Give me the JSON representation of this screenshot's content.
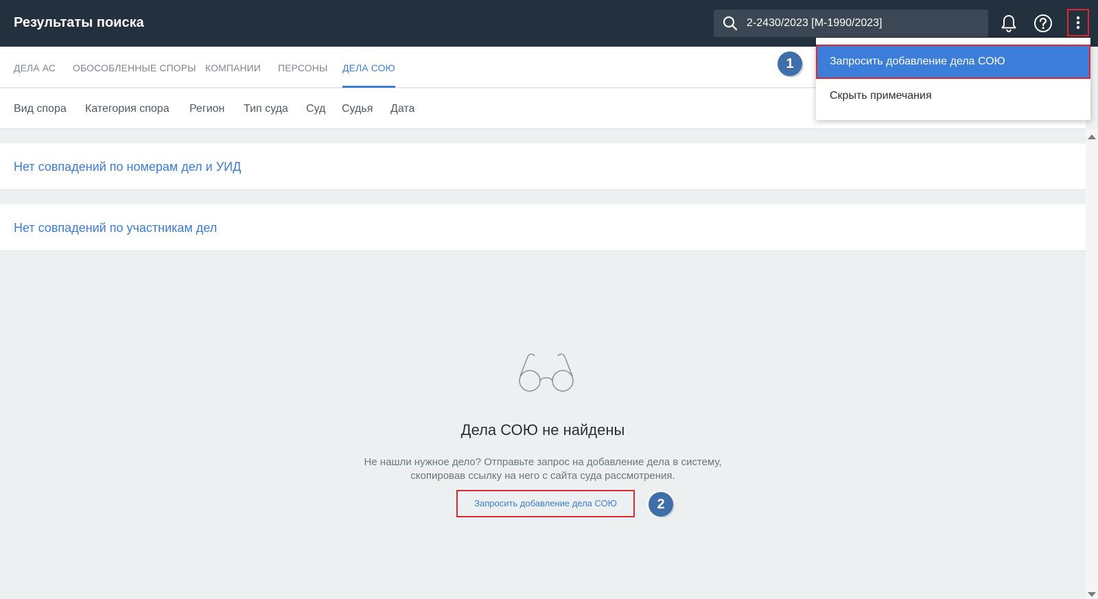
{
  "header": {
    "title": "Результаты поиска",
    "search_value": "2-2430/2023 [М-1990/2023]",
    "icons": {
      "search": "search-icon",
      "bell": "bell-icon",
      "help": "help-icon",
      "more": "more-vertical-icon"
    }
  },
  "tabs": [
    {
      "label": "ДЕЛА АС",
      "active": false
    },
    {
      "label": "ОБОСОБЛЕННЫЕ СПОРЫ",
      "active": false
    },
    {
      "label": "КОМПАНИИ",
      "active": false
    },
    {
      "label": "ПЕРСОНЫ",
      "active": false
    },
    {
      "label": "ДЕЛА СОЮ",
      "active": true
    }
  ],
  "filters": [
    "Вид спора",
    "Категория спора",
    "Регион",
    "Тип суда",
    "Суд",
    "Судья",
    "Дата"
  ],
  "results": {
    "no_case_numbers": "Нет совпадений по номерам дел и УИД",
    "no_participants": "Нет совпадений по участникам дел"
  },
  "empty_state": {
    "icon": "glasses-icon",
    "title": "Дела СОЮ не найдены",
    "text_line1": "Не нашли нужное дело? Отправьте запрос на добавление дела в систему,",
    "text_line2": "скопировав ссылку на него с сайта суда рассмотрения.",
    "link": "Запросить добавление дела СОЮ"
  },
  "menu": {
    "items": [
      "Запросить добавление дела СОЮ",
      "Скрыть примечания"
    ]
  },
  "badges": [
    "1",
    "2"
  ],
  "colors": {
    "header_bg": "#23303e",
    "accent": "#3b7dd8",
    "highlight_border": "#e0262e",
    "badge": "#3f6fa9"
  }
}
